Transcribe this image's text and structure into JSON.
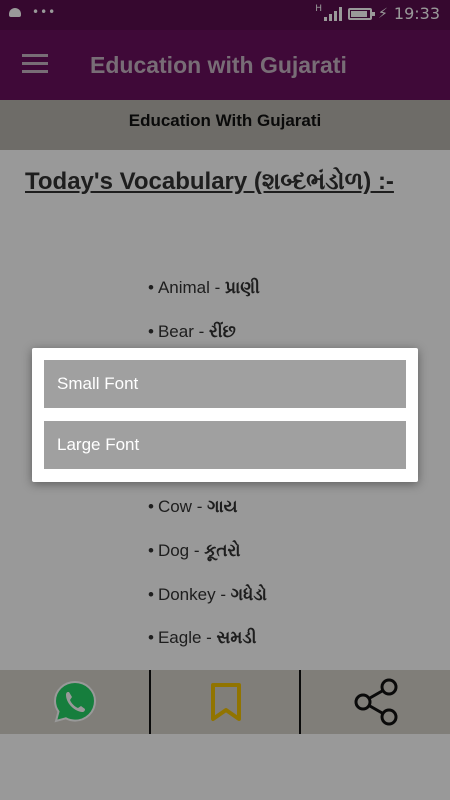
{
  "status_bar": {
    "dots": "•••",
    "network_label": "H",
    "time": "19:33",
    "battery_level": 0.9
  },
  "app_bar": {
    "title": "Education with Gujarati",
    "menu_icon": "hamburger-menu-icon"
  },
  "sub_header": {
    "title": "Education With Gujarati"
  },
  "content": {
    "heading": "Today's Vocabulary (શબ્દભંડોળ) :-",
    "bullet": "•",
    "separator": " - ",
    "items": [
      {
        "en": "Animal",
        "gu": "પ્રાણી"
      },
      {
        "en": "Bear",
        "gu": "રીંછ"
      },
      {
        "en": "Cow",
        "gu": "ગાય"
      },
      {
        "en": "Dog",
        "gu": "કૂતરો"
      },
      {
        "en": "Donkey",
        "gu": "ગધેડો"
      },
      {
        "en": "Eagle",
        "gu": "સમડી"
      }
    ]
  },
  "bottom_bar": {
    "buttons": [
      {
        "icon": "whatsapp-icon",
        "color": "#25d366"
      },
      {
        "icon": "bookmark-icon",
        "color": "#f2c200"
      },
      {
        "icon": "share-icon",
        "color": "#111111"
      }
    ]
  },
  "dialog": {
    "options": [
      "Small Font",
      "Large Font"
    ]
  },
  "colors": {
    "status_bar": "#5a0e4f",
    "app_bar": "#6a0f5e",
    "sub_header": "#b8b5ad",
    "dialog_option": "#a0a0a0"
  }
}
